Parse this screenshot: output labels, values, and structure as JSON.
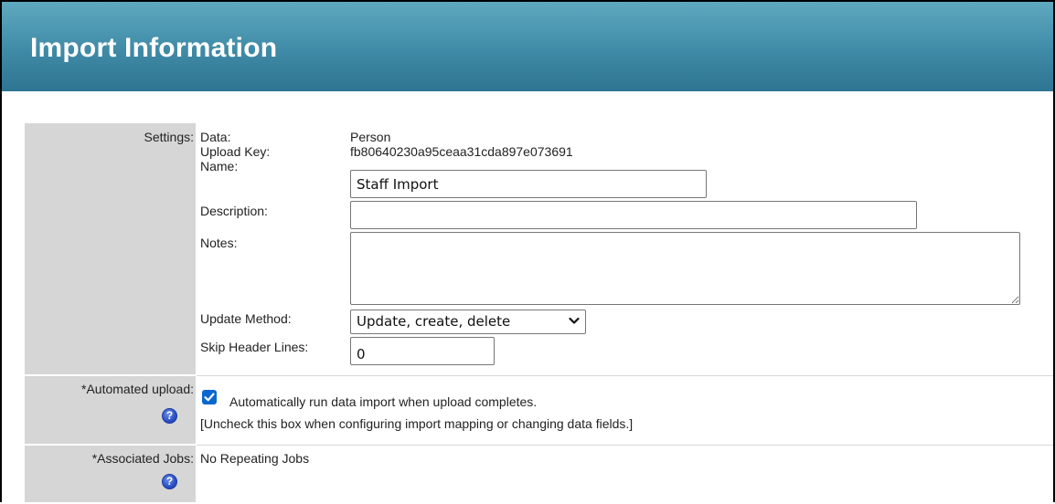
{
  "header": {
    "title": "Import Information"
  },
  "settings": {
    "label": "Settings:",
    "data_label": "Data:",
    "data_value": "Person",
    "upload_key_label": "Upload Key:",
    "upload_key_value": "fb80640230a95ceaa31cda897e073691",
    "name_label": "Name:",
    "name_value": "Staff Import",
    "description_label": "Description:",
    "description_value": "",
    "notes_label": "Notes:",
    "notes_value": "",
    "update_method_label": "Update Method:",
    "update_method_value": "Update, create, delete",
    "skip_header_label": "Skip Header Lines:",
    "skip_header_value": "0"
  },
  "automated_upload": {
    "label": "*Automated upload:",
    "checked": true,
    "checkbox_text": "Automatically run data import when upload completes.",
    "hint": "[Uncheck this box when configuring import mapping or changing data fields.]",
    "help_glyph": "?"
  },
  "associated_jobs": {
    "label": "*Associated Jobs:",
    "value": "No Repeating Jobs",
    "help_glyph": "?"
  },
  "icons": {
    "help": "help-icon",
    "checkbox": "check-icon",
    "select_arrow": "chevron-down-icon"
  },
  "colors": {
    "header_bg": "#3f8aa6",
    "label_bg": "#d6d6d6",
    "checkbox": "#0b67d0",
    "help_icon": "#2a50c4"
  }
}
